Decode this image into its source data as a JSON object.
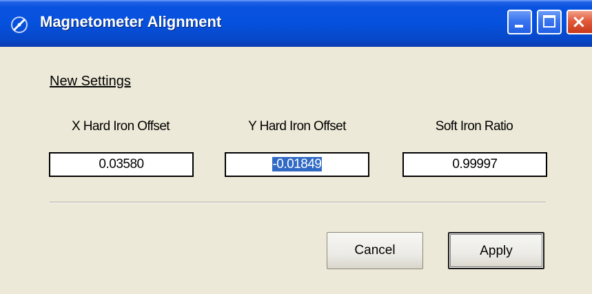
{
  "window": {
    "title": "Magnetometer Alignment",
    "icon": "magnetometer-app-icon",
    "controls": {
      "minimize": "minimize-icon",
      "maximize": "maximize-icon",
      "close": "close-icon",
      "close_glyph": "×"
    }
  },
  "section": {
    "label": "New Settings"
  },
  "fields": [
    {
      "label": "X Hard Iron Offset",
      "value": "0.03580",
      "selected": false
    },
    {
      "label": "Y Hard Iron Offset",
      "value": "-0.01849",
      "selected": true
    },
    {
      "label": "Soft Iron Ratio",
      "value": "0.99997",
      "selected": false
    }
  ],
  "buttons": {
    "cancel": "Cancel",
    "apply": "Apply"
  },
  "colors": {
    "titlebar": "#0551dd",
    "dialog_bg": "#ece9d8",
    "selection": "#316ac5",
    "close_button": "#e25a3b"
  }
}
